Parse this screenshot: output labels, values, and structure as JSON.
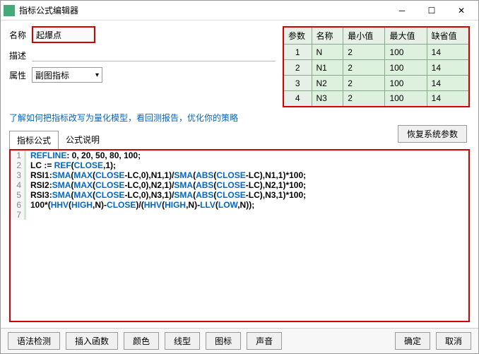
{
  "window": {
    "title": "指标公式编辑器"
  },
  "form": {
    "name_label": "名称",
    "name_value": "起爆点",
    "desc_label": "描述",
    "prop_label": "属性",
    "prop_value": "副图指标"
  },
  "param_headers": [
    "参数",
    "名称",
    "最小值",
    "最大值",
    "缺省值"
  ],
  "params": [
    {
      "idx": "1",
      "name": "N",
      "min": "2",
      "max": "100",
      "def": "14"
    },
    {
      "idx": "2",
      "name": "N1",
      "min": "2",
      "max": "100",
      "def": "14"
    },
    {
      "idx": "3",
      "name": "N2",
      "min": "2",
      "max": "100",
      "def": "14"
    },
    {
      "idx": "4",
      "name": "N3",
      "min": "2",
      "max": "100",
      "def": "14"
    }
  ],
  "help_link": "了解如何把指标改写为量化模型，看回测报告，优化你的策略",
  "restore_btn": "恢复系统参数",
  "tabs": {
    "formula": "指标公式",
    "explain": "公式说明"
  },
  "code": [
    "REFLINE: 0, 20, 50, 80, 100;",
    "LC := REF(CLOSE,1);",
    "RSI1:SMA(MAX(CLOSE-LC,0),N1,1)/SMA(ABS(CLOSE-LC),N1,1)*100;",
    "RSI2:SMA(MAX(CLOSE-LC,0),N2,1)/SMA(ABS(CLOSE-LC),N2,1)*100;",
    "RSI3:SMA(MAX(CLOSE-LC,0),N3,1)/SMA(ABS(CLOSE-LC),N3,1)*100;",
    "100*(HHV(HIGH,N)-CLOSE)/(HHV(HIGH,N)-LLV(LOW,N));",
    ""
  ],
  "footer": {
    "syntax": "语法检测",
    "insert_fn": "插入函数",
    "color": "颜色",
    "line": "线型",
    "chart": "图标",
    "sound": "声音",
    "ok": "确定",
    "cancel": "取消"
  }
}
